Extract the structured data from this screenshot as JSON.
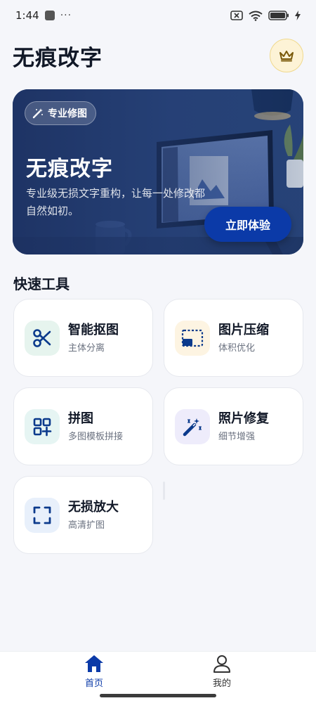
{
  "status_bar": {
    "time": "1:44",
    "dots": "···",
    "battery": "100"
  },
  "header": {
    "title": "无痕改字"
  },
  "banner": {
    "tag": "专业修图",
    "title": "无痕改字",
    "description": "专业级无损文字重构，让每一处修改都自然如初。",
    "cta": "立即体验"
  },
  "section": {
    "title": "快速工具"
  },
  "tools": [
    {
      "title": "智能抠图",
      "subtitle": "主体分离",
      "icon": "scissors-icon",
      "bg": "#e6f4ee",
      "color": "#0b3a8c"
    },
    {
      "title": "图片压缩",
      "subtitle": "体积优化",
      "icon": "compress-icon",
      "bg": "#fdf4e2",
      "color": "#0b3a8c"
    },
    {
      "title": "拼图",
      "subtitle": "多图模板拼接",
      "icon": "collage-icon",
      "bg": "#e6f5f3",
      "color": "#0b3a8c"
    },
    {
      "title": "照片修复",
      "subtitle": "细节增强",
      "icon": "magic-wand-icon",
      "bg": "#eeecfb",
      "color": "#0b3a8c"
    },
    {
      "title": "无损放大",
      "subtitle": "高清扩图",
      "icon": "expand-icon",
      "bg": "#e8f0fb",
      "color": "#0b3a8c"
    }
  ],
  "nav": [
    {
      "label": "首页",
      "icon": "home-icon",
      "active": true
    },
    {
      "label": "我的",
      "icon": "profile-icon",
      "active": false
    }
  ],
  "colors": {
    "accent": "#0b3aa8",
    "active_nav": "#0b3aa8",
    "inactive_nav": "#333333",
    "vip_gold": "#8a6a10"
  }
}
